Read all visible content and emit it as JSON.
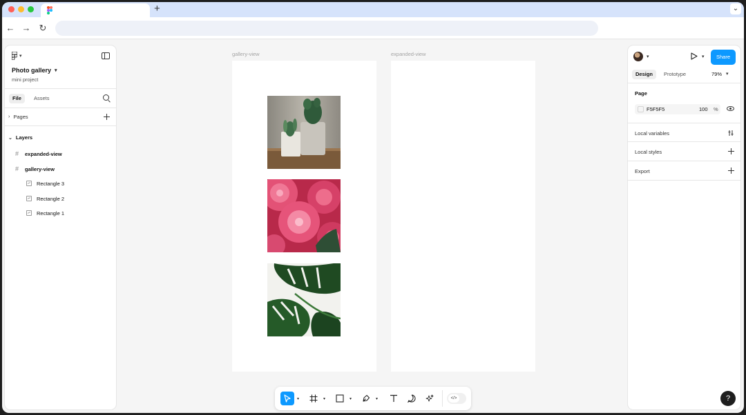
{
  "browser": {
    "new_tab_symbol": "+",
    "tab_menu_symbol": "⌄",
    "back_symbol": "←",
    "forward_symbol": "→",
    "reload_symbol": "↻",
    "url_value": ""
  },
  "left_panel": {
    "file_name": "Photo gallery",
    "file_subtitle": "mini project",
    "tabs": [
      "File",
      "Assets"
    ],
    "pages_label": "Pages",
    "layers_label": "Layers",
    "layers": [
      {
        "name": "expanded-view",
        "type": "frame"
      },
      {
        "name": "gallery-view",
        "type": "frame"
      },
      {
        "name": "Rectangle 3",
        "type": "image"
      },
      {
        "name": "Rectangle 2",
        "type": "image"
      },
      {
        "name": "Rectangle 1",
        "type": "image"
      }
    ]
  },
  "canvas": {
    "frames": [
      {
        "label": "gallery-view"
      },
      {
        "label": "expanded-view"
      }
    ],
    "photos": [
      "succulents-photo",
      "dahlia-photo",
      "monstera-photo"
    ]
  },
  "toolbar": {
    "tools": [
      "move-tool",
      "frame-tool",
      "shape-tool",
      "pen-tool",
      "text-tool",
      "comment-tool",
      "actions-tool"
    ],
    "dev_mode_symbol": "</>"
  },
  "right_panel": {
    "share_label": "Share",
    "tabs": [
      "Design",
      "Prototype"
    ],
    "zoom": "79%",
    "page_title": "Page",
    "page_color": "F5F5F5",
    "page_opacity": "100",
    "percent_symbol": "%",
    "sections": [
      "Local variables",
      "Local styles",
      "Export"
    ]
  },
  "help_label": "?",
  "colors": {
    "accent": "#0d99ff",
    "canvas": "#f5f5f5",
    "tab_strip": "#d6e3fb"
  }
}
